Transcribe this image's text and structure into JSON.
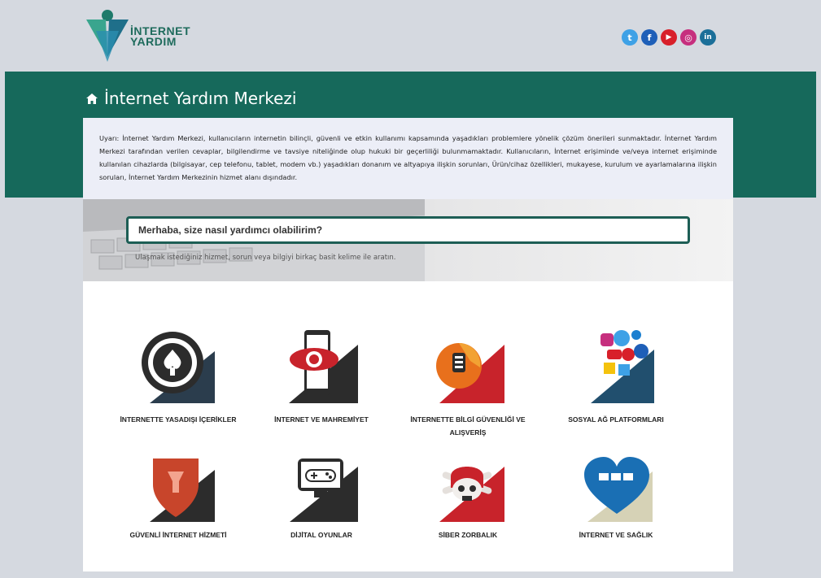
{
  "header": {
    "logo_text_line1": "İNTERNET",
    "logo_text_line2": "YARDIM",
    "socials": [
      {
        "name": "twitter-icon",
        "glyph": "t",
        "color": "#3ea1e6"
      },
      {
        "name": "facebook-icon",
        "glyph": "f",
        "color": "#1e5fb8"
      },
      {
        "name": "youtube-icon",
        "glyph": "▶",
        "color": "#d8202a"
      },
      {
        "name": "instagram-icon",
        "glyph": "◎",
        "color": "#c62f7e"
      },
      {
        "name": "linkedin-icon",
        "glyph": "in",
        "color": "#1b6f99"
      }
    ]
  },
  "page_title": "İnternet Yardım Merkezi",
  "warning_text": "Uyarı: İnternet Yardım Merkezi, kullanıcıların internetin bilinçli, güvenli ve etkin kullanımı kapsamında yaşadıkları problemlere yönelik çözüm önerileri sunmaktadır. İnternet Yardım Merkezi tarafından verilen cevaplar, bilgilendirme ve tavsiye niteliğinde olup hukuki bir geçerliliği bulunmamaktadır. Kullanıcıların, İnternet erişiminde ve/veya internet erişiminde kullanılan cihazlarda (bilgisayar, cep telefonu, tablet, modem vb.) yaşadıkları donanım ve altyapıya ilişkin sorunları, Ürün/cihaz özellikleri, mukayese, kurulum ve ayarlamalarına ilişkin soruları, İnternet Yardım Merkezinin hizmet alanı dışındadır.",
  "search": {
    "placeholder": "Merhaba, size nasıl yardımcı olabilirim?",
    "hint": "Ulaşmak istediğiniz hizmet, sorun veya bilgiyi birkaç basit kelime ile aratın."
  },
  "categories": [
    {
      "label": "İNTERNETTE YASADIŞI İÇERİKLER",
      "icon": "illegal-content-icon"
    },
    {
      "label": "İNTERNET VE MAHREMİYET",
      "icon": "privacy-eye-icon"
    },
    {
      "label": "İNTERNETTE BİLGİ GÜVENLİĞİ VE ALIŞVERİŞ",
      "icon": "security-shopping-icon"
    },
    {
      "label": "SOSYAL AĞ PLATFORMLARI",
      "icon": "social-networks-icon"
    },
    {
      "label": "GÜVENLİ İNTERNET HİZMETİ",
      "icon": "safe-internet-shield-icon"
    },
    {
      "label": "DİJİTAL OYUNLAR",
      "icon": "gamepad-icon"
    },
    {
      "label": "SİBER ZORBALIK",
      "icon": "skull-icon"
    },
    {
      "label": "İNTERNET VE SAĞLIK",
      "icon": "heart-icon"
    }
  ]
}
